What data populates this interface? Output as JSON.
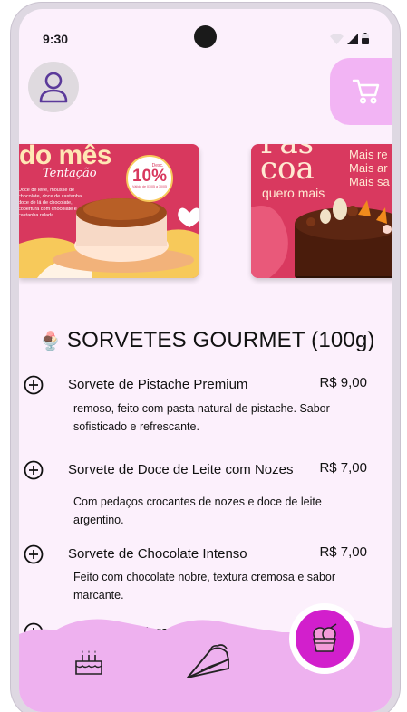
{
  "status_bar": {
    "time": "9:30"
  },
  "header": {
    "avatar_icon": "user-avatar-icon",
    "cart_icon": "shopping-cart-icon"
  },
  "banners": [
    {
      "headline": "do mês",
      "script": "Tentação",
      "badge_percent": "10%",
      "badge_small_top": "Desc.",
      "badge_small_bottom": "Válido de 01/05 a 30/05",
      "description": "Doce de leite, mousse de chocolate, doce de castanha, doce de lá de chocolate, cobertura com chocolate e castanha ralada."
    },
    {
      "headline_line1": "Pás",
      "headline_line2": "coa",
      "script": "quero mais",
      "side_text": [
        "Mais re",
        "Mais ar",
        "Mais sa"
      ]
    }
  ],
  "section": {
    "emoji": "🍨",
    "title": "SORVETES GOURMET (100g)"
  },
  "items": [
    {
      "name": "Sorvete de Pistache Premium",
      "price": "R$ 9,00",
      "desc_line1": "remoso, feito com pasta natural de pistache. Sabor",
      "desc_line2": "sofisticado e refrescante."
    },
    {
      "name": "Sorvete de Doce de Leite com Nozes",
      "price": "R$ 7,00",
      "desc_line1": "Com pedaços crocantes de nozes e doce de leite argentino.",
      "desc_line2": ""
    },
    {
      "name": "Sorvete de Chocolate Intenso",
      "price": "R$ 7,00",
      "desc_line1": "Feito com chocolate nobre, textura cremosa e sabor",
      "desc_line2": "marcante."
    },
    {
      "name": "Sorvete de Morango com Am",
      "price": "",
      "desc_line1": "",
      "desc_line2": ""
    }
  ],
  "bottom_nav": {
    "items": [
      "cake-icon",
      "pie-slice-icon",
      "ice-cream-icon"
    ],
    "active": "ice-cream-icon"
  },
  "colors": {
    "background": "#fcf0fc",
    "accent_pink": "#f2b4f4",
    "nav_wave": "#eeb1ef",
    "active_fab": "#d21fcc",
    "banner_red": "#d9395f"
  }
}
